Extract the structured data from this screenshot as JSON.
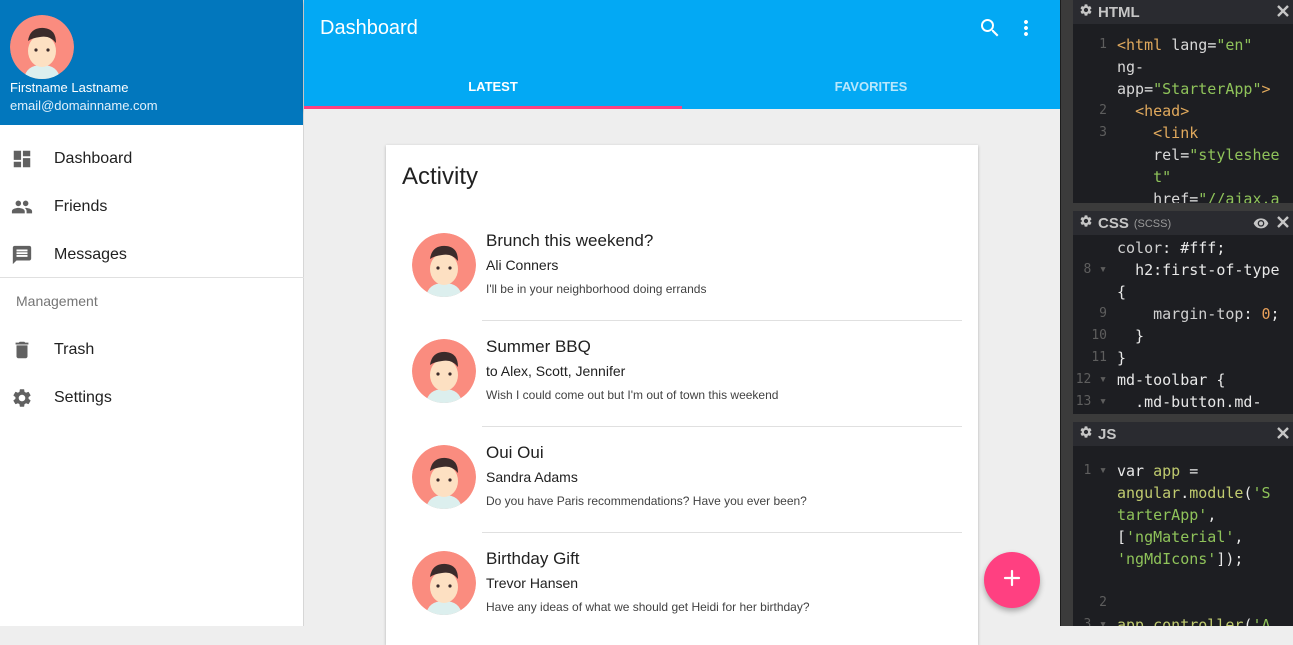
{
  "sidebar": {
    "user_name": "Firstname Lastname",
    "user_email": "email@domainname.com",
    "nav": [
      {
        "label": "Dashboard",
        "icon": "dashboard-icon"
      },
      {
        "label": "Friends",
        "icon": "people-icon"
      },
      {
        "label": "Messages",
        "icon": "message-icon"
      }
    ],
    "subheader": "Management",
    "management": [
      {
        "label": "Trash",
        "icon": "trash-icon"
      },
      {
        "label": "Settings",
        "icon": "gear-icon"
      }
    ]
  },
  "toolbar": {
    "title": "Dashboard",
    "tabs": [
      {
        "label": "LATEST",
        "active": true
      },
      {
        "label": "FAVORITES",
        "active": false
      }
    ]
  },
  "card": {
    "title": "Activity",
    "items": [
      {
        "title": "Brunch this weekend?",
        "who": "Ali Conners",
        "notes": "I'll be in your neighborhood doing errands"
      },
      {
        "title": "Summer BBQ",
        "who": "to Alex, Scott, Jennifer",
        "notes": "Wish I could come out but I'm out of town this weekend"
      },
      {
        "title": "Oui Oui",
        "who": "Sandra Adams",
        "notes": "Do you have Paris recommendations? Have you ever been?"
      },
      {
        "title": "Birthday Gift",
        "who": "Trevor Hansen",
        "notes": "Have any ideas of what we should get Heidi for her birthday?"
      }
    ]
  },
  "fab": {
    "icon": "plus-icon"
  },
  "colors": {
    "sidebar_header": "#0277bd",
    "toolbar": "#03a9f4",
    "accent": "#ff4081"
  },
  "editor": {
    "html_panel": {
      "title": "HTML"
    },
    "css_panel": {
      "title": "CSS",
      "subtitle": "(SCSS)"
    },
    "js_panel": {
      "title": "JS"
    }
  }
}
